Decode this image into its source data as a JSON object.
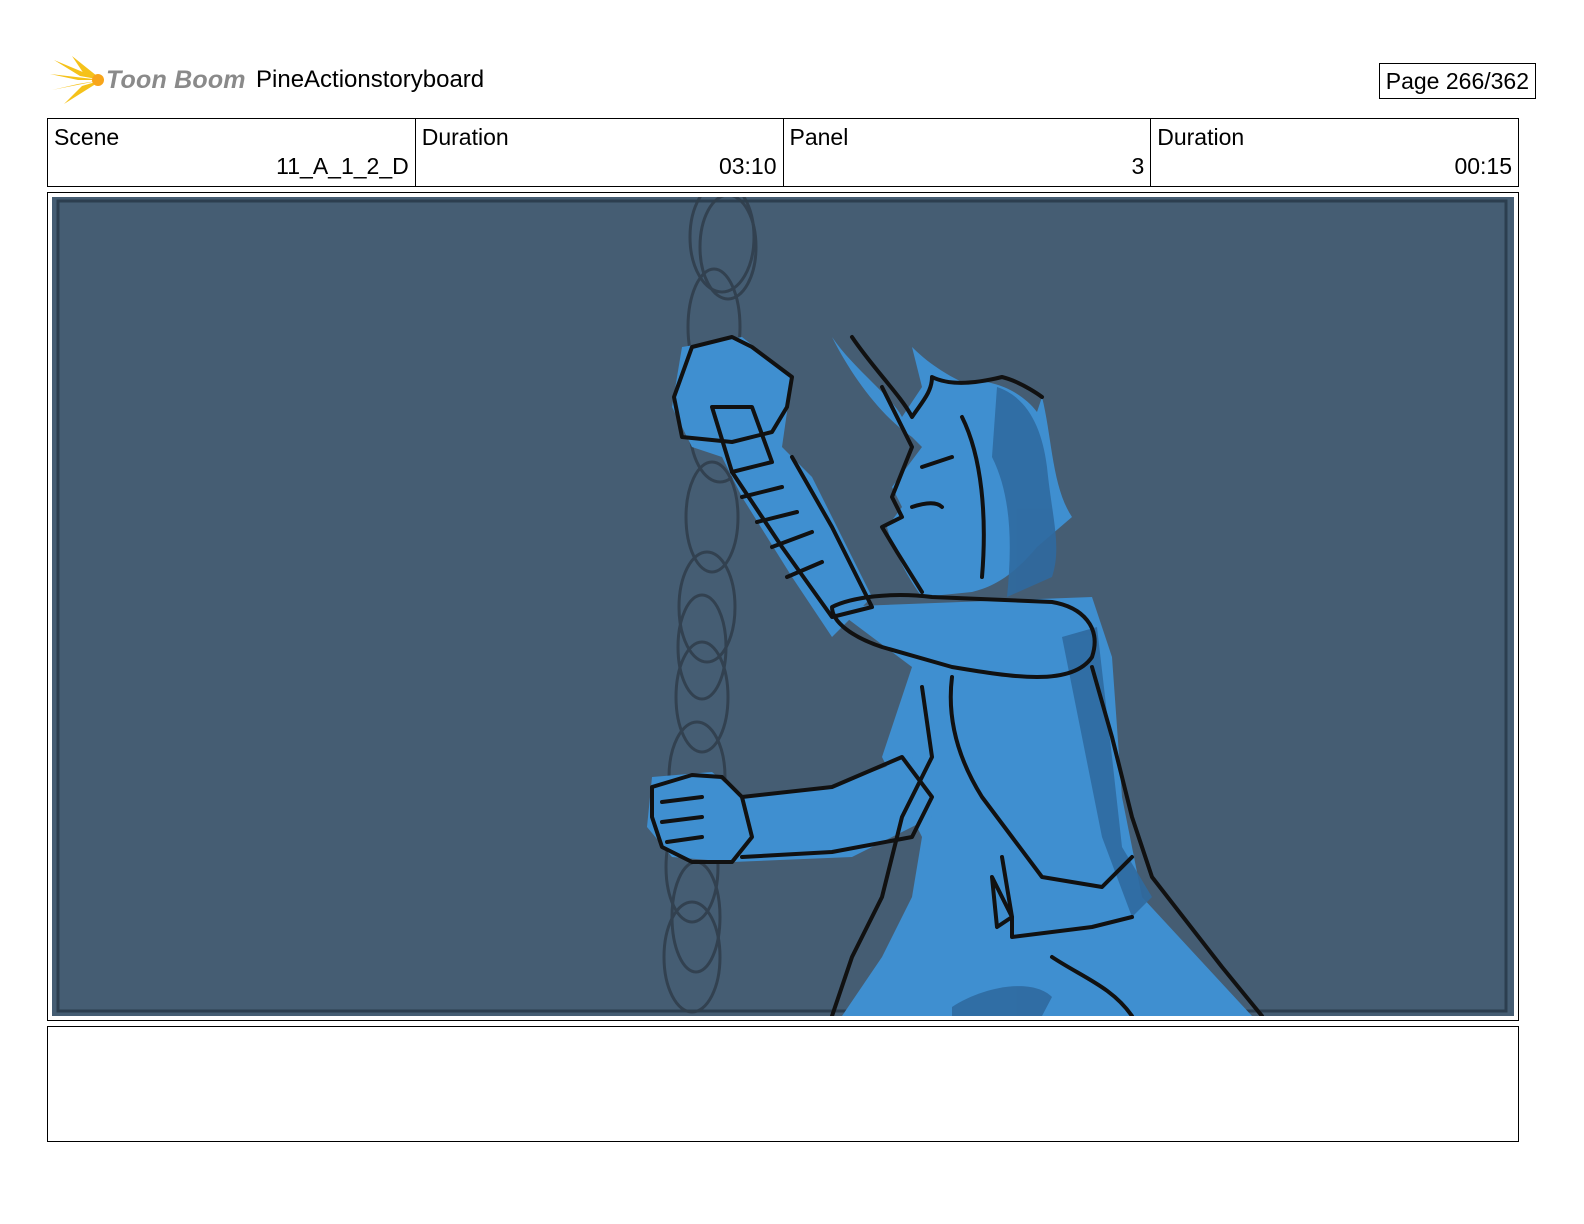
{
  "header": {
    "logo_text": "Toon Boom",
    "logo_icon": "starburst-logo-icon",
    "project_title": "PineActionstoryboard",
    "page_label": "Page 266/362"
  },
  "info": {
    "scene_label": "Scene",
    "scene_value": "11_A_1_2_D",
    "scene_duration_label": "Duration",
    "scene_duration_value": "03:10",
    "panel_label": "Panel",
    "panel_value": "3",
    "panel_duration_label": "Duration",
    "panel_duration_value": "00:15"
  },
  "panel": {
    "background_color": "#455d73",
    "character_color": "#3f8fd0",
    "shadow_color": "#2f6aa0",
    "chain_color": "#2f3d4a"
  },
  "notes": {
    "text": ""
  }
}
